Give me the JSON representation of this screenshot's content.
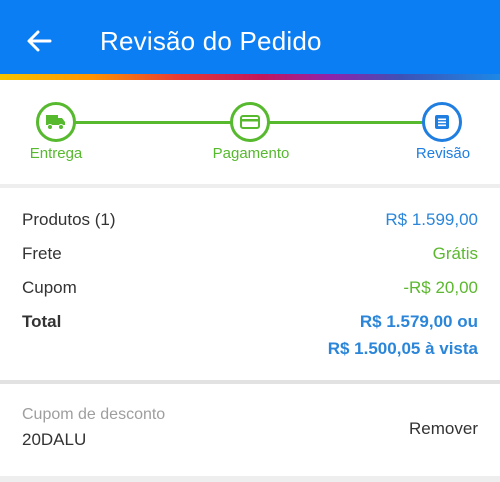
{
  "header": {
    "title": "Revisão do Pedido",
    "back_icon": "arrow-left-icon",
    "background_color": "#0b7ef4"
  },
  "stepper": {
    "steps": [
      {
        "label": "Entrega",
        "icon": "truck-icon",
        "state": "completed"
      },
      {
        "label": "Pagamento",
        "icon": "credit-card-icon",
        "state": "completed"
      },
      {
        "label": "Revisão",
        "icon": "list-icon",
        "state": "active"
      }
    ],
    "completed_color": "#56b92e",
    "active_color": "#1f7ee0"
  },
  "summary": {
    "products": {
      "label": "Produtos (1)",
      "value": "R$ 1.599,00"
    },
    "shipping": {
      "label": "Frete",
      "value": "Grátis"
    },
    "coupon": {
      "label": "Cupom",
      "value": "-R$ 20,00"
    },
    "total": {
      "label": "Total",
      "value_line1": "R$ 1.579,00 ou",
      "value_line2": "R$ 1.500,05 à vista"
    }
  },
  "coupon_section": {
    "label": "Cupom de desconto",
    "code": "20DALU",
    "remove_label": "Remover"
  }
}
